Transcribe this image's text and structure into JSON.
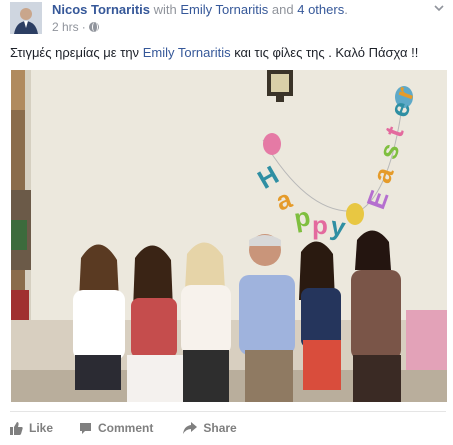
{
  "post": {
    "author": "Nicos Tornaritis",
    "with_text": "with",
    "tagged_person": "Emily Tornaritis",
    "and_text": "and",
    "others": "4 others",
    "end_period": ".",
    "time": "2 hrs",
    "time_sep": "·",
    "text_before": "Στιγμές ηρεμίας με την",
    "text_tag": "Emily Tornaritis",
    "text_after": "και τις φίλες της . Καλό Πάσχα !!",
    "banner_letters": [
      "H",
      "a",
      "p",
      "p",
      "y",
      "E",
      "a",
      "s",
      "t",
      "e",
      "r"
    ],
    "icons": {
      "privacy": "globe-icon",
      "menu": "chevron-down-icon",
      "like": "thumbs-up-icon",
      "comment": "comment-bubble-icon",
      "share": "share-arrow-icon"
    }
  },
  "actions": {
    "like": "Like",
    "comment": "Comment",
    "share": "Share"
  },
  "colors": {
    "link": "#365899",
    "meta": "#90949c",
    "text": "#1d2129",
    "action": "#7f7f7f"
  }
}
